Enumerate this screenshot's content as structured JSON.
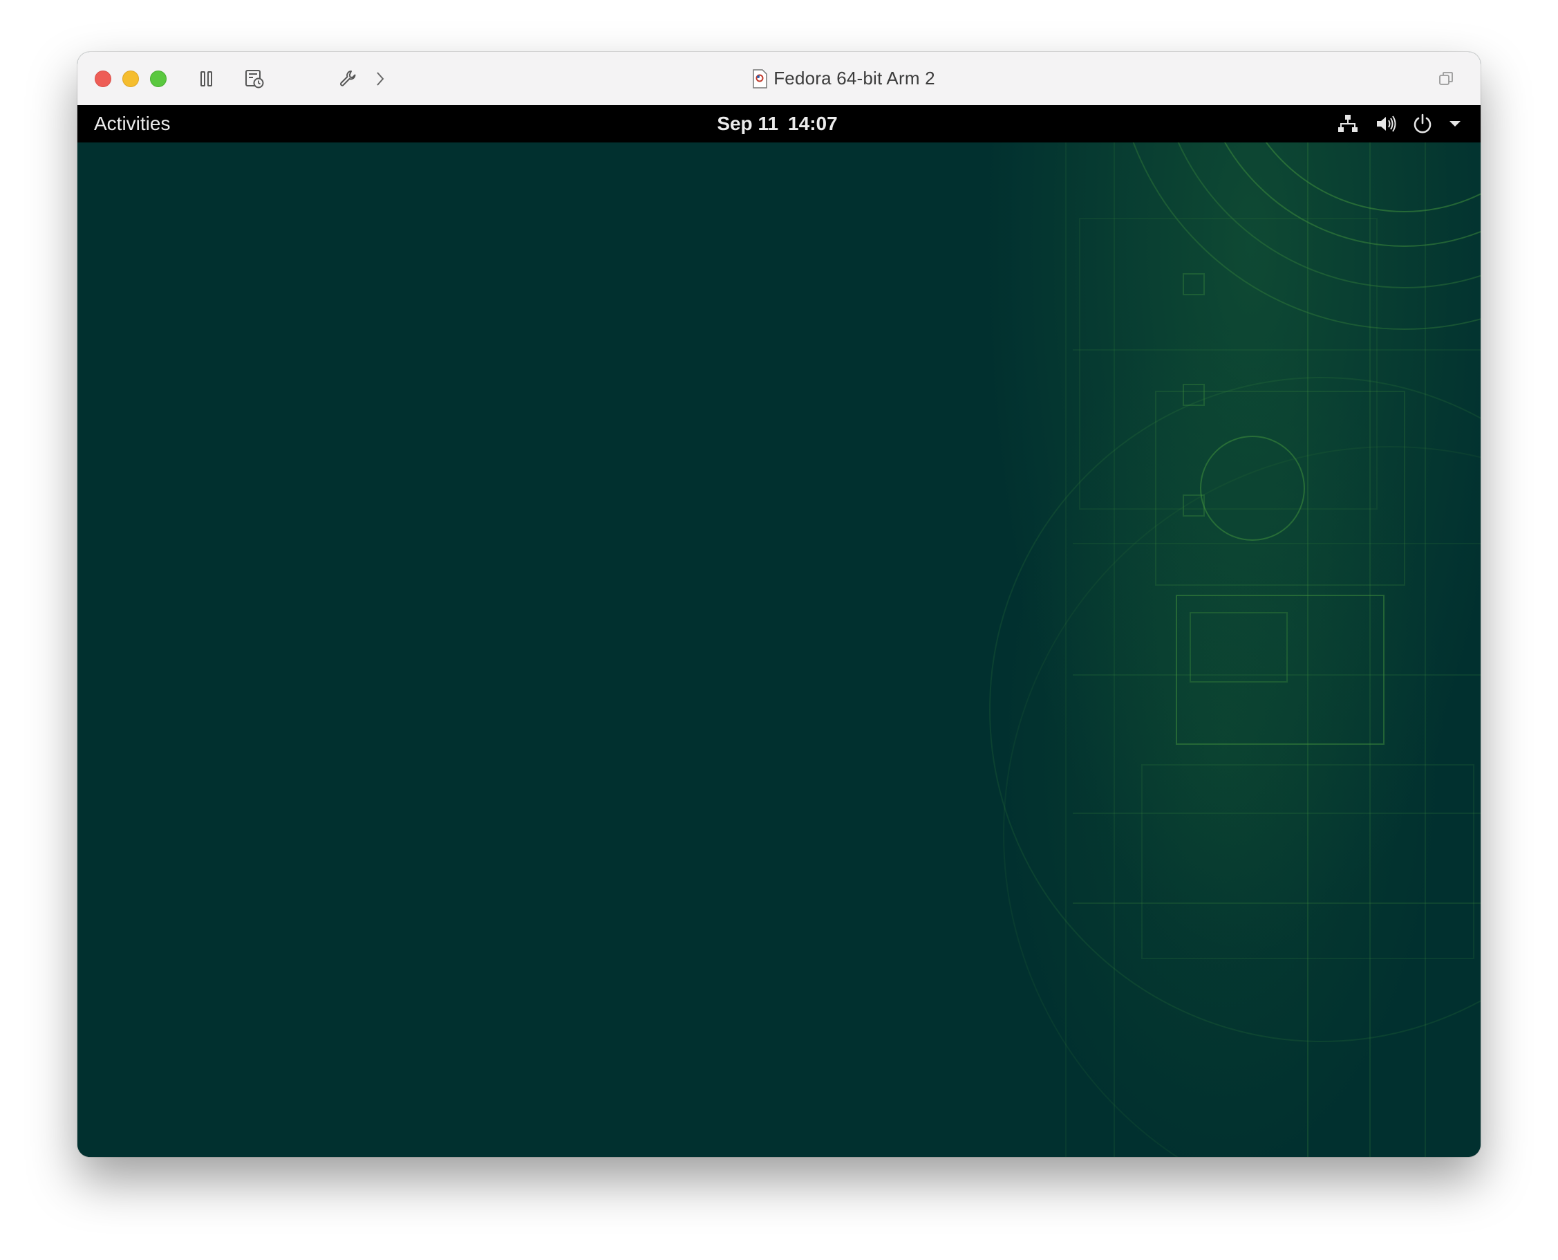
{
  "window": {
    "title": "Fedora 64-bit Arm 2",
    "toolbar": {
      "pause_icon": "pause-icon",
      "snapshot_icon": "snapshot-icon",
      "settings_icon": "wrench-icon",
      "more_icon": "chevron-right-icon",
      "restore_icon": "restore-window-icon"
    },
    "colors": {
      "titlebar_bg": "#f4f3f4",
      "close": "#ee5d56",
      "minimize": "#f5bd2e",
      "maximize": "#5ac83f"
    }
  },
  "gnome": {
    "activities_label": "Activities",
    "date": "Sep 11",
    "time": "14:07",
    "status_icons": [
      "network-wired-icon",
      "volume-icon",
      "power-icon",
      "dropdown-arrow-icon"
    ],
    "colors": {
      "top_bar_bg": "#000000",
      "desktop_bg": "#01302f",
      "wallpaper_accent": "#2f7a3a"
    }
  }
}
